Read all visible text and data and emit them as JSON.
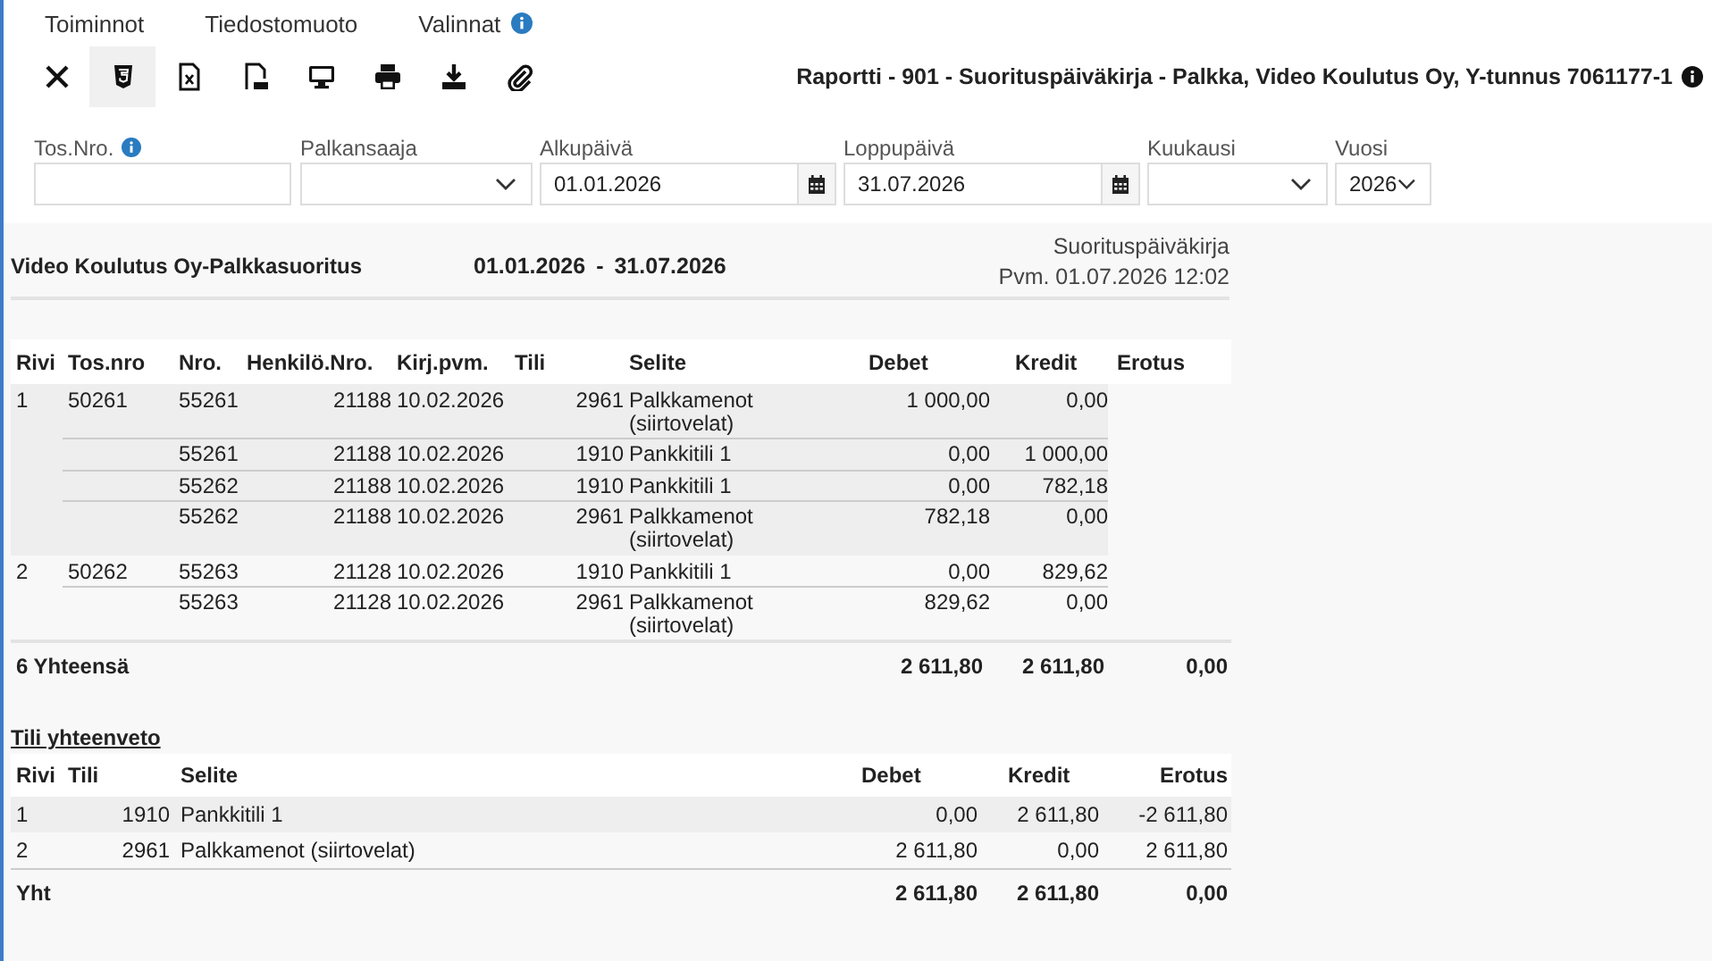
{
  "menu": [
    {
      "label": "Toiminnot",
      "info": false
    },
    {
      "label": "Tiedostomuoto",
      "info": false
    },
    {
      "label": "Valinnat",
      "info": true
    }
  ],
  "toolbar": [
    {
      "kind": "close",
      "selected": false
    },
    {
      "kind": "html",
      "selected": true
    },
    {
      "kind": "excel",
      "selected": false
    },
    {
      "kind": "pdf",
      "selected": false
    },
    {
      "kind": "screen",
      "selected": false
    },
    {
      "kind": "print",
      "selected": false
    },
    {
      "kind": "download",
      "selected": false
    },
    {
      "kind": "attach",
      "selected": false
    }
  ],
  "report_title": "Raportti - 901 - Suorituspäiväkirja - Palkka, Video Koulutus Oy, Y-tunnus 7061177-1",
  "filters": [
    {
      "label": "Tos.Nro.",
      "info": true,
      "kind": "text"
    },
    {
      "label": "Palkansaaja",
      "info": false,
      "kind": "select"
    },
    {
      "label": "Alkupäivä",
      "info": false,
      "kind": "date",
      "value": "01.01.2026"
    },
    {
      "label": "Loppupäivä",
      "info": false,
      "kind": "date",
      "value": "31.07.2026"
    },
    {
      "label": "Kuukausi",
      "info": false,
      "kind": "select"
    },
    {
      "label": "Vuosi",
      "info": false,
      "kind": "select",
      "value": "2026"
    }
  ],
  "report": {
    "company": "Video Koulutus Oy-Palkkasuoritus",
    "date_from": "01.01.2026",
    "date_sep": "-",
    "date_to": "31.07.2026",
    "type": "Suorituspäiväkirja",
    "printed": "Pvm. 01.07.2026 12:02",
    "columns": [
      "Rivi",
      "Tos.nro",
      "Nro.",
      "Henkilö.Nro.",
      "Kirj.pvm.",
      "Tili",
      "Selite",
      "Debet",
      "Kredit",
      "Erotus"
    ],
    "groups": [
      {
        "rivi": "1",
        "tos_nro": "50261",
        "lines": [
          [
            "55261",
            "21188",
            "10.02.2026",
            "2961",
            "Palkkamenot (siirtovelat)",
            "1 000,00",
            "0,00"
          ],
          [
            "55261",
            "21188",
            "10.02.2026",
            "1910",
            "Pankkitili 1",
            "0,00",
            "1 000,00"
          ],
          [
            "55262",
            "21188",
            "10.02.2026",
            "1910",
            "Pankkitili 1",
            "0,00",
            "782,18"
          ],
          [
            "55262",
            "21188",
            "10.02.2026",
            "2961",
            "Palkkamenot (siirtovelat)",
            "782,18",
            "0,00"
          ]
        ]
      },
      {
        "rivi": "2",
        "tos_nro": "50262",
        "lines": [
          [
            "55263",
            "21128",
            "10.02.2026",
            "1910",
            "Pankkitili 1",
            "0,00",
            "829,62"
          ],
          [
            "55263",
            "21128",
            "10.02.2026",
            "2961",
            "Palkkamenot (siirtovelat)",
            "829,62",
            "0,00"
          ]
        ]
      }
    ],
    "total": {
      "label": "6 Yhteensä",
      "debet": "2 611,80",
      "kredit": "2 611,80",
      "erotus": "0,00"
    }
  },
  "summary": {
    "title": "Tili yhteenveto",
    "columns": [
      "Rivi",
      "Tili",
      "Selite",
      "Debet",
      "Kredit",
      "Erotus"
    ],
    "rows": [
      [
        "1",
        "1910",
        "Pankkitili 1",
        "0,00",
        "2 611,80",
        "-2 611,80"
      ],
      [
        "2",
        "2961",
        "Palkkamenot (siirtovelat)",
        "2 611,80",
        "0,00",
        "2 611,80"
      ]
    ],
    "total": [
      "Yht",
      "2 611,80",
      "2 611,80",
      "0,00"
    ]
  }
}
